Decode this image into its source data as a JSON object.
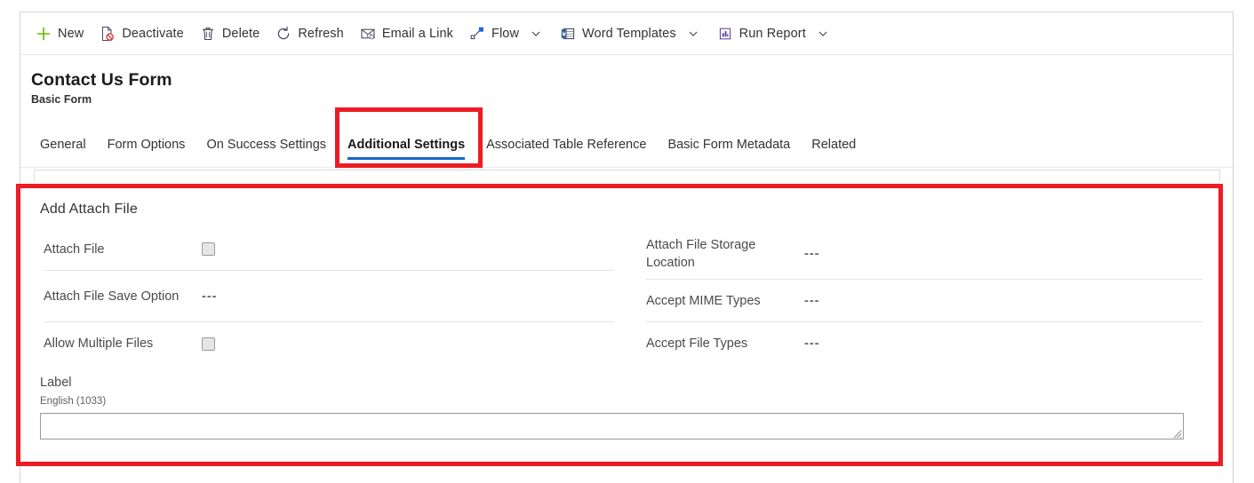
{
  "command_bar": {
    "items": [
      {
        "label": "New",
        "icon": "plus-icon",
        "has_chevron": false
      },
      {
        "label": "Deactivate",
        "icon": "deactivate-icon",
        "has_chevron": false
      },
      {
        "label": "Delete",
        "icon": "trash-icon",
        "has_chevron": false
      },
      {
        "label": "Refresh",
        "icon": "refresh-icon",
        "has_chevron": false
      },
      {
        "label": "Email a Link",
        "icon": "email-link-icon",
        "has_chevron": false
      },
      {
        "label": "Flow",
        "icon": "flow-icon",
        "has_chevron": true
      },
      {
        "label": "Word Templates",
        "icon": "word-template-icon",
        "has_chevron": true
      },
      {
        "label": "Run Report",
        "icon": "run-report-icon",
        "has_chevron": true
      }
    ]
  },
  "record": {
    "title": "Contact Us Form",
    "subtitle": "Basic Form"
  },
  "tabs": [
    {
      "label": "General",
      "active": false
    },
    {
      "label": "Form Options",
      "active": false
    },
    {
      "label": "On Success Settings",
      "active": false
    },
    {
      "label": "Additional Settings",
      "active": true
    },
    {
      "label": "Associated Table Reference",
      "active": false
    },
    {
      "label": "Basic Form Metadata",
      "active": false
    },
    {
      "label": "Related",
      "active": false
    }
  ],
  "section": {
    "title": "Add Attach File",
    "left_fields": [
      {
        "label": "Attach File",
        "type": "checkbox",
        "value": "",
        "checked": false
      },
      {
        "label": "Attach File Save Option",
        "type": "text",
        "value": "---"
      },
      {
        "label": "Allow Multiple Files",
        "type": "checkbox",
        "value": "",
        "checked": false
      }
    ],
    "right_fields": [
      {
        "label": "Attach File Storage Location",
        "type": "text",
        "value": "---"
      },
      {
        "label": "Accept MIME Types",
        "type": "text",
        "value": "---"
      },
      {
        "label": "Accept File Types",
        "type": "text",
        "value": "---"
      }
    ],
    "label_block": {
      "title": "Label",
      "language": "English (1033)",
      "value": "",
      "placeholder": ""
    }
  },
  "annotations": {
    "accent_color": "#ed1c24",
    "tab_highlight": "Additional Settings",
    "section_highlight": "Add Attach File"
  },
  "colors": {
    "tab_active_underline": "#1268d1",
    "new_icon": "#6bb700",
    "text_primary": "#1b1b1b",
    "text_secondary": "#4a4a4a"
  }
}
